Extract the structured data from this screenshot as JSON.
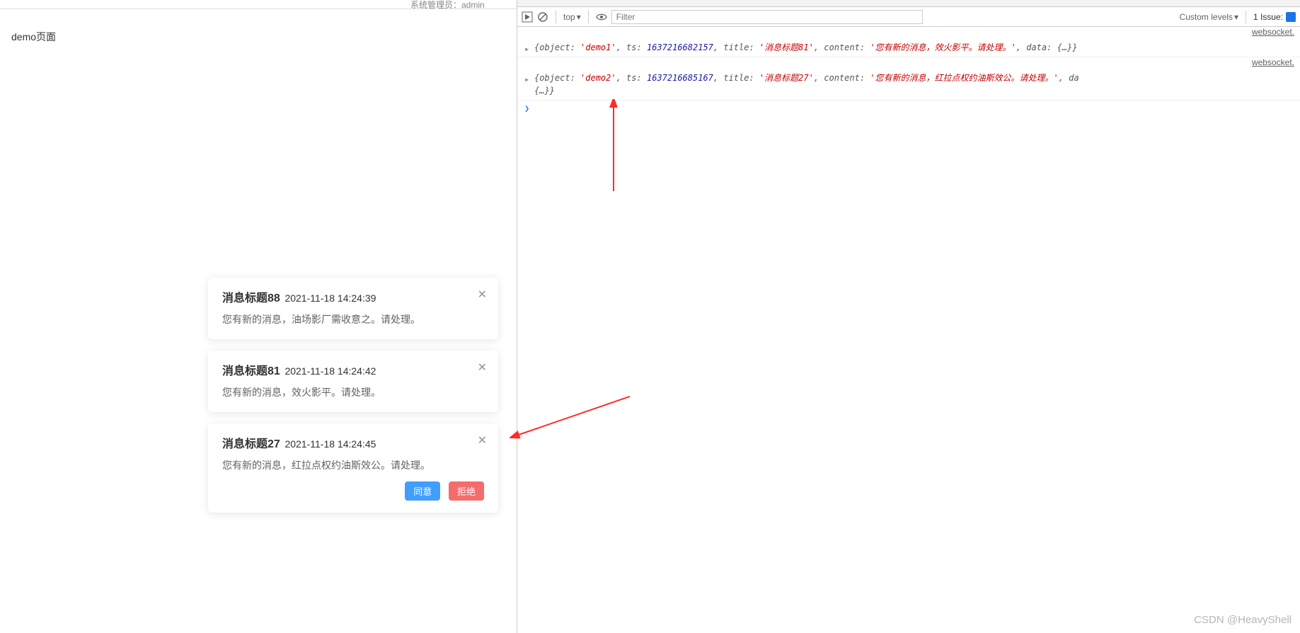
{
  "page": {
    "title": "demo页面"
  },
  "headerCut": "系统管理员：admin",
  "notifications": [
    {
      "title": "消息标题88",
      "ts": "2021-11-18 14:24:39",
      "content": "您有新的消息，油场影厂需收意之。请处理。",
      "actions": false
    },
    {
      "title": "消息标题81",
      "ts": "2021-11-18 14:24:42",
      "content": "您有新的消息，效火影平。请处理。",
      "actions": false
    },
    {
      "title": "消息标题27",
      "ts": "2021-11-18 14:24:45",
      "content": "您有新的消息，红拉点权约油斯效公。请处理。",
      "actions": true
    }
  ],
  "buttons": {
    "agree": "同意",
    "refuse": "拒绝"
  },
  "devtools": {
    "context": "top",
    "filterPlaceholder": "Filter",
    "levels": "Custom levels",
    "issues": "1 Issue:",
    "srcLink": "websocket.",
    "log1": {
      "object": "'demo1'",
      "ts": "1637216682157",
      "title": "'消息标题81'",
      "content": "'您有新的消息，效火影平。请处理。'",
      "data": "{…}}"
    },
    "log2": {
      "object": "'demo2'",
      "ts": "1637216685167",
      "title": "'消息标题27'",
      "content": "'您有新的消息，红拉点权约油斯效公。请处理。'",
      "data_prefix": "da",
      "trail": "{…}}"
    }
  },
  "watermark": "CSDN @HeavyShell"
}
